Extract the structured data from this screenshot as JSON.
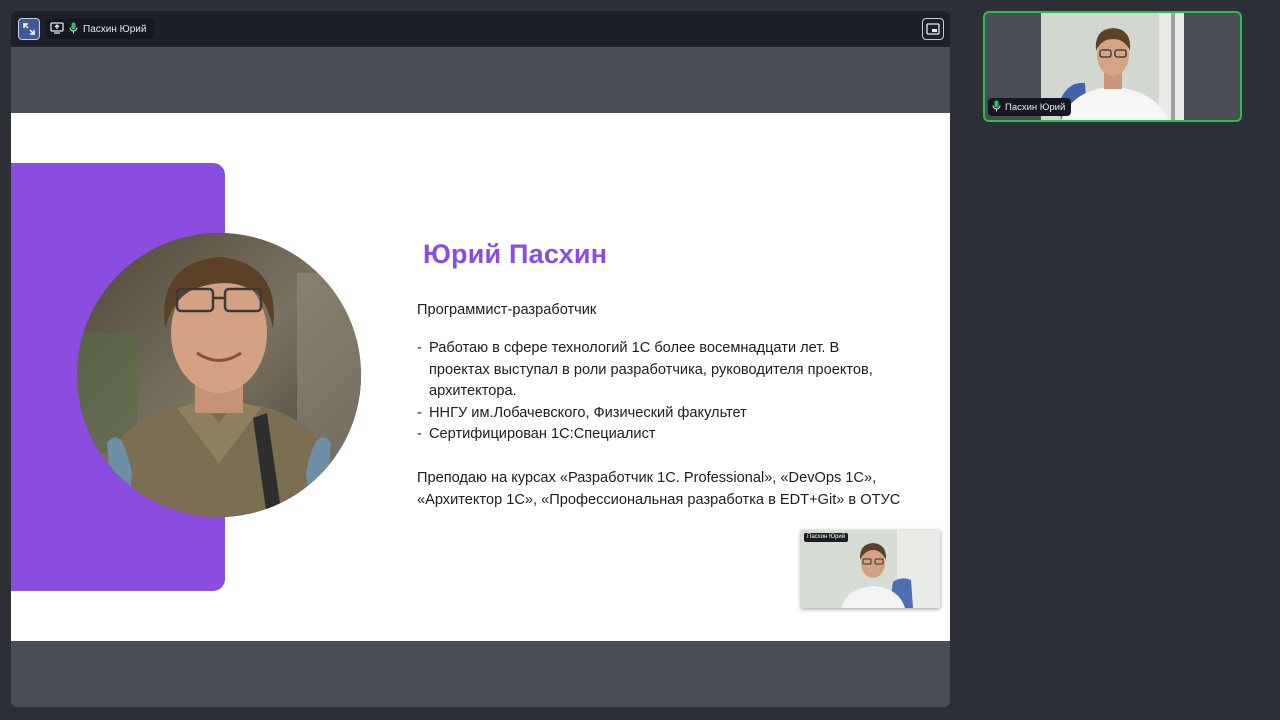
{
  "share": {
    "presenter_name": "Пасхин Юрий",
    "icons": {
      "expand": "expand-icon",
      "screen_share": "screen-share-icon",
      "mic": "mic-icon",
      "pip": "picture-in-picture-icon"
    }
  },
  "slide": {
    "name": "Юрий Пасхин",
    "role": "Программист-разработчик",
    "bullets": [
      "Работаю в сфере технологий 1С более восемнадцати лет. В проектах выступал в роли разработчика, руководителя проектов, архитектора.",
      "ННГУ им.Лобачевского, Физический факультет",
      "Сертифицирован 1С:Специалист"
    ],
    "courses": "Преподаю на курсах «Разработчик 1С. Professional», «DevOps 1С», «Архитектор 1С», «Профессиональная разработка в EDT+Git» в ОТУС",
    "embedded_camera_label": "Пасхин Юрий"
  },
  "video_tile": {
    "participant_name": "Пасхин Юрий",
    "mic_icon": "mic-icon"
  },
  "colors": {
    "accent_purple": "#8a4de0",
    "speaking_border": "#27c048",
    "background": "#2c2f36",
    "share_area": "#4a4d56"
  }
}
